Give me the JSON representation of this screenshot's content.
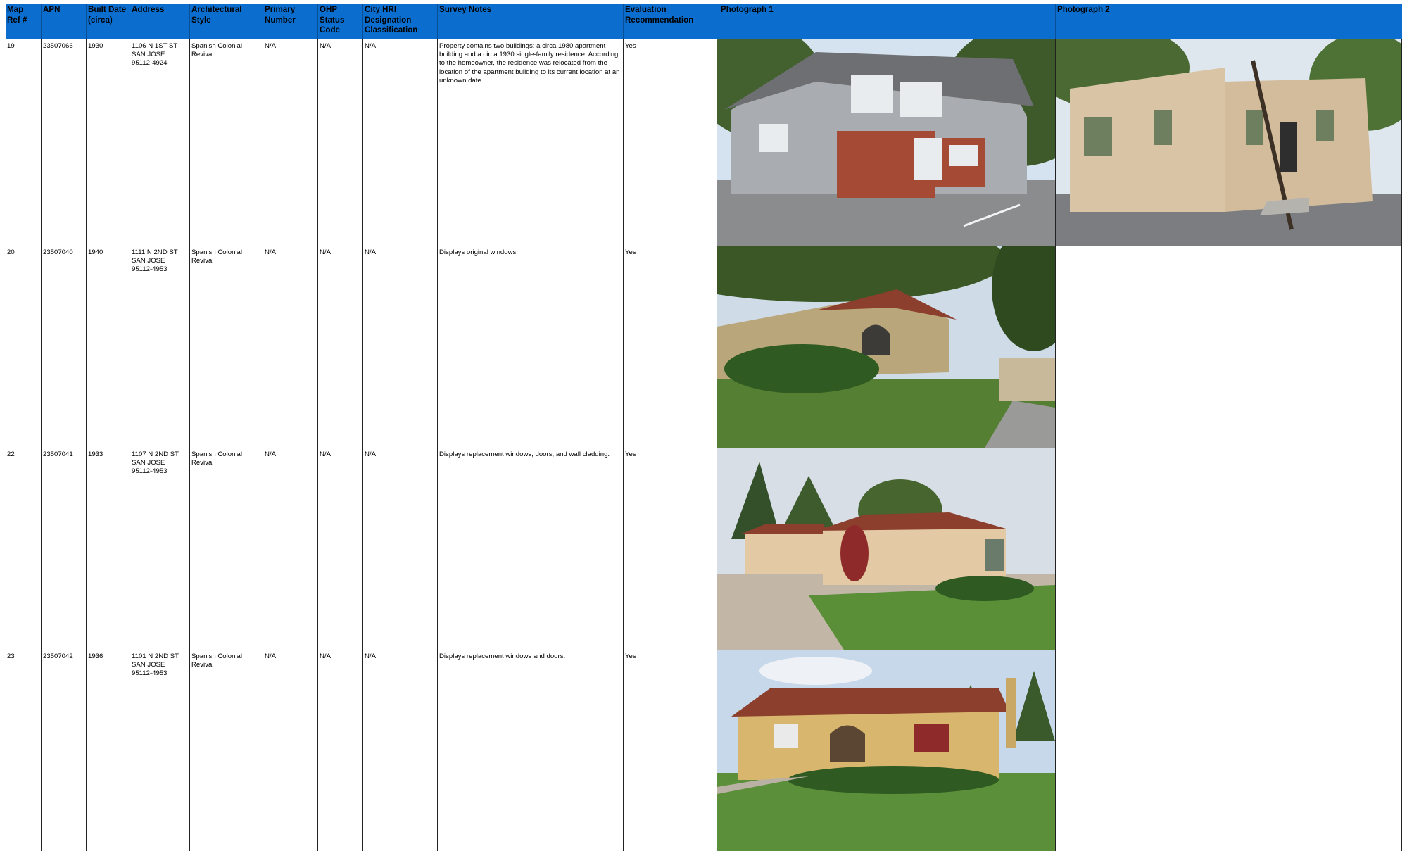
{
  "columns": [
    {
      "label": "Map\nRef #"
    },
    {
      "label": "APN"
    },
    {
      "label": "Built Date\n(circa)"
    },
    {
      "label": "Address"
    },
    {
      "label": "Architectural\nStyle"
    },
    {
      "label": "Primary\nNumber"
    },
    {
      "label": "OHP\nStatus\nCode"
    },
    {
      "label": "City HRI\nDesignation\nClassification"
    },
    {
      "label": "Survey Notes"
    },
    {
      "label": "Evaluation\nRecommendation"
    },
    {
      "label": "Photograph 1"
    },
    {
      "label": "Photograph 2"
    }
  ],
  "rows": [
    {
      "map_ref": "19",
      "apn": "23507066",
      "built": "1930",
      "address": "1106 N 1ST ST\nSAN JOSE\n95112-4924",
      "style": "Spanish Colonial\nRevival",
      "primary": "N/A",
      "ohp": "N/A",
      "hri": "N/A",
      "notes": "Property contains two buildings: a circa 1980 apartment building and a circa 1930 single-family residence. According to the homeowner, the residence was relocated from the location of the apartment building to its current location at an unknown date.",
      "evaluation": "Yes",
      "photo1": "two-story-apartment-building-photo",
      "photo2": "beige-stucco-residence-photo"
    },
    {
      "map_ref": "20",
      "apn": "23507040",
      "built": "1940",
      "address": "1111 N 2ND ST\nSAN JOSE\n95112-4953",
      "style": "Spanish Colonial\nRevival",
      "primary": "N/A",
      "ohp": "N/A",
      "hri": "N/A",
      "notes": "Displays original windows.",
      "evaluation": "Yes",
      "photo1": "house-with-arched-window-photo"
    },
    {
      "map_ref": "22",
      "apn": "23507041",
      "built": "1933",
      "address": "1107 N 2ND ST\nSAN JOSE\n95112-4953",
      "style": "Spanish Colonial\nRevival",
      "primary": "N/A",
      "ohp": "N/A",
      "hri": "N/A",
      "notes": "Displays replacement windows, doors, and wall cladding.",
      "evaluation": "Yes",
      "photo1": "tile-roof-house-with-driveway-photo"
    },
    {
      "map_ref": "23",
      "apn": "23507042",
      "built": "1936",
      "address": "1101 N 2ND ST\nSAN JOSE\n95112-4953",
      "style": "Spanish Colonial\nRevival",
      "primary": "N/A",
      "ohp": "N/A",
      "hri": "N/A",
      "notes": "Displays replacement windows and doors.",
      "evaluation": "Yes",
      "photo1": "yellow-house-with-arch-entry-photo"
    }
  ],
  "colors": {
    "header": "#0b6ecf",
    "grass": "#4f8a34",
    "sky": "#c9d8e6",
    "tile_roof": "#8b3f2c"
  }
}
